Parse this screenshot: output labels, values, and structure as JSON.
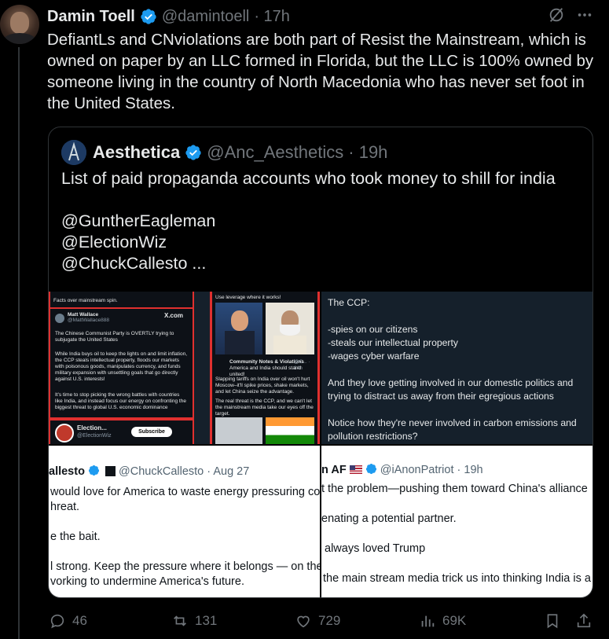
{
  "tweet": {
    "author_name": "Damin Toell",
    "author_handle": "@damintoell",
    "time": "· 17h",
    "text": "DefiantLs and CNviolations are both part of Resist the Mainstream, which is owned on paper by an LLC formed in Florida, but the LLC is 100% owned by someone living in the country of North Macedonia who has never set foot in the United States."
  },
  "quote": {
    "author_name": "Aesthetica",
    "author_handle": "@Anc_Aesthetics",
    "time": "· 19h",
    "text": "List of paid propaganda accounts who took money to shill for india\n\n@GuntherEagleman\n@ElectionWiz\n@ChuckCallesto ..."
  },
  "media": {
    "tile1": {
      "top_line": "Facts over mainstream spin.",
      "post_author": "Matt Wallace",
      "post_handle": "@MattWallace888",
      "site": "X.com",
      "line1": "The Chinese Communist Party is OVERTLY trying to subjugate the United States",
      "line2": "While India buys oil to keep the lights on and limit inflation, the CCP steals intellectual property, floods our markets with poisonous goods, manipulates currency, and funds military expansion with unsettling goals that go directly against U.S. interests!",
      "line3": "It's time to stop picking the wrong battles with countries like India, and instead focus our energy on confronting the biggest threat to global U.S. economic dominance",
      "account_name": "Election...",
      "account_handle": "@ElectionWiz",
      "subscribe": "Subscribe",
      "right_caption": "Use leverage where it works!",
      "cn_name": "Community Notes & Violations",
      "cn_handle": "@C... · 14h",
      "cn_line1": "America and India should stand united!",
      "cn_line2": "Slapping tariffs on India over oil won't hurt Moscow–it'll spike prices, shake markets, and let China seize the advantage.",
      "cn_line3": "The real threat is the CCP, and we can't let the mainstream media take our eyes off the target."
    },
    "tile2": {
      "lines": [
        "The CCP:",
        "",
        "-spies on our citizens",
        "-steals our intellectual property",
        "-wages cyber warfare",
        "",
        "And they love getting involved in our domestic politics and trying to distract us away from their egregious actions",
        "",
        "Notice how they're never involved in carbon emissions and pollution restrictions?"
      ]
    },
    "tile3": {
      "name": "allesto",
      "handle": "@ChuckCallesto",
      "time": "· Aug 27",
      "lines": [
        "would love for America to waste energy pressuring co",
        "hreat.",
        "e the bait.",
        "l strong. Keep the pressure where it belongs — on the",
        "vorking to undermine America's future."
      ]
    },
    "tile4": {
      "name": "n AF",
      "handle": "@iAnonPatriot",
      "time": "· 19h",
      "lines": [
        "t the problem—pushing them toward China's alliance",
        "enating a potential partner.",
        "always loved Trump",
        "the main stream media trick us into thinking India is a"
      ]
    }
  },
  "actions": {
    "replies": "46",
    "reposts": "131",
    "likes": "729",
    "views": "69K"
  },
  "colors": {
    "background": "#000000",
    "text": "#e7e9ea",
    "muted": "#71767b",
    "verified": "#1d9bf0",
    "accent_red": "#e0302f"
  }
}
